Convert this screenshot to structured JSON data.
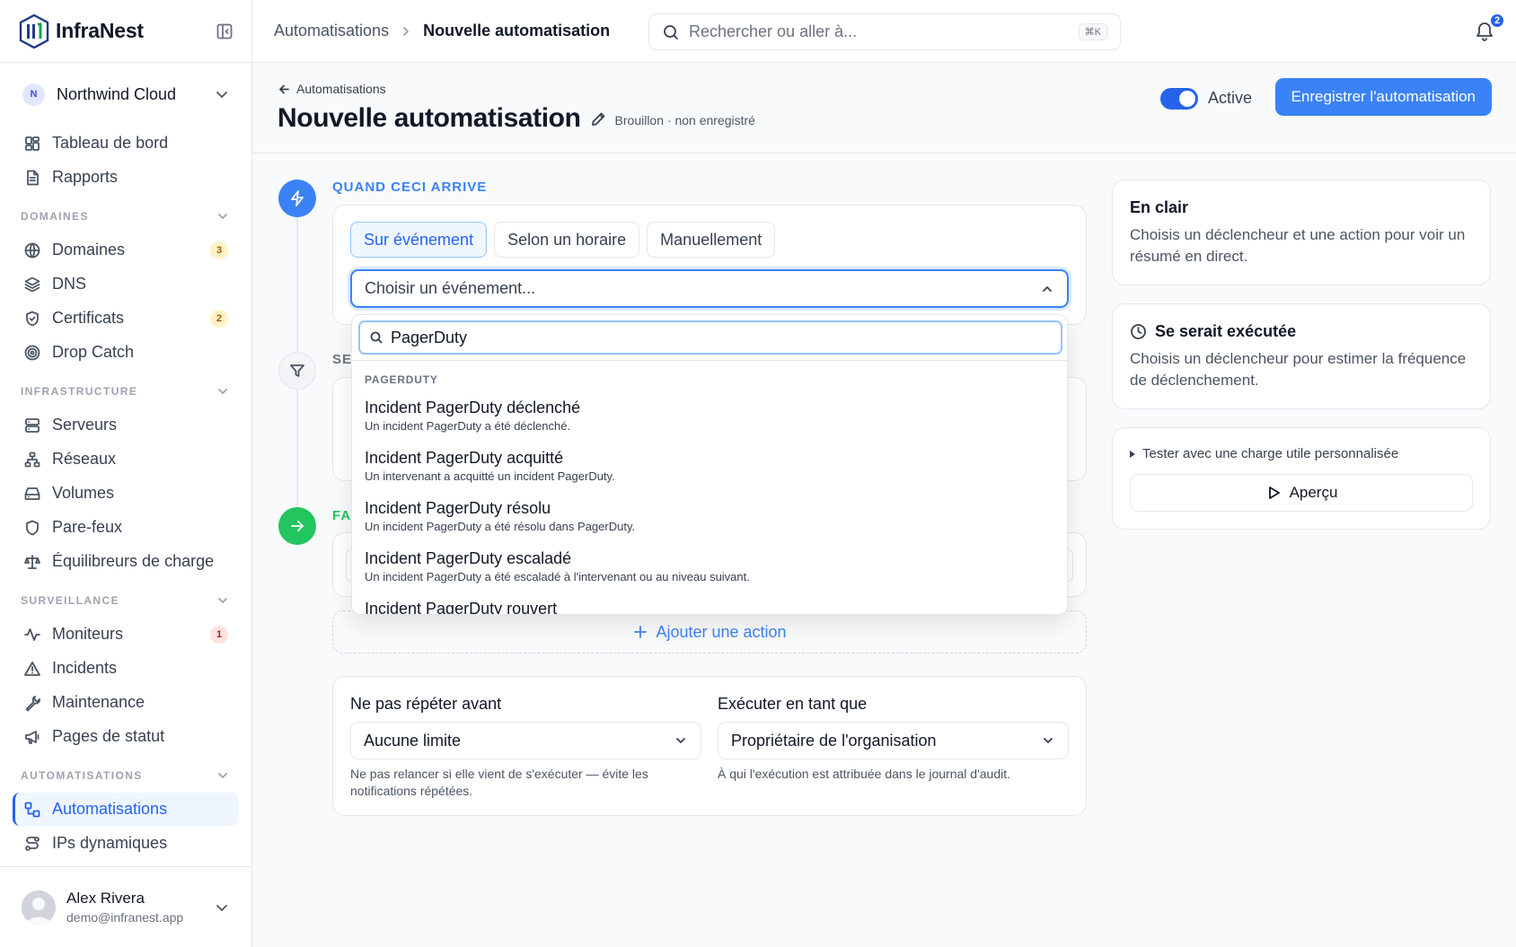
{
  "brand": {
    "name": "InfraNest"
  },
  "org": {
    "initial": "N",
    "name": "Northwind Cloud"
  },
  "nav": {
    "top": [
      {
        "label": "Tableau de bord",
        "icon": "dashboard-icon"
      },
      {
        "label": "Rapports",
        "icon": "report-icon"
      }
    ],
    "sections": [
      {
        "title": "DOMAINES",
        "items": [
          {
            "label": "Domaines",
            "icon": "globe-icon",
            "count": "3"
          },
          {
            "label": "DNS",
            "icon": "layers-icon"
          },
          {
            "label": "Certificats",
            "icon": "shield-check-icon",
            "count": "2"
          },
          {
            "label": "Drop Catch",
            "icon": "target-icon"
          }
        ]
      },
      {
        "title": "INFRASTRUCTURE",
        "items": [
          {
            "label": "Serveurs",
            "icon": "server-icon"
          },
          {
            "label": "Réseaux",
            "icon": "network-icon"
          },
          {
            "label": "Volumes",
            "icon": "hard-drive-icon"
          },
          {
            "label": "Pare-feux",
            "icon": "shield-icon"
          },
          {
            "label": "Équilibreurs de charge",
            "icon": "scale-icon"
          }
        ]
      },
      {
        "title": "SURVEILLANCE",
        "items": [
          {
            "label": "Moniteurs",
            "icon": "activity-icon",
            "count": "1"
          },
          {
            "label": "Incidents",
            "icon": "alert-triangle-icon"
          },
          {
            "label": "Maintenance",
            "icon": "wrench-icon"
          },
          {
            "label": "Pages de statut",
            "icon": "megaphone-icon"
          }
        ]
      },
      {
        "title": "AUTOMATISATIONS",
        "items": [
          {
            "label": "Automatisations",
            "icon": "workflow-icon",
            "active": true
          },
          {
            "label": "IPs dynamiques",
            "icon": "route-icon"
          }
        ]
      }
    ]
  },
  "user": {
    "name": "Alex Rivera",
    "email": "demo@infranest.app"
  },
  "topbar": {
    "crumb_parent": "Automatisations",
    "crumb_current": "Nouvelle automatisation",
    "search_placeholder": "Rechercher ou aller à...",
    "search_shortcut": "⌘K",
    "notif_count": "2"
  },
  "header": {
    "back_label": "Automatisations",
    "title": "Nouvelle automatisation",
    "status": "Brouillon · non enregistré",
    "active_label": "Active",
    "save_label": "Enregistrer l'automatisation"
  },
  "trigger": {
    "label": "QUAND CECI ARRIVE",
    "tabs": [
      "Sur événement",
      "Selon un horaire",
      "Manuellement"
    ],
    "event_placeholder": "Choisir un événement..."
  },
  "filter": {
    "label": "SE"
  },
  "action": {
    "label": "FA",
    "add_label": "Ajouter une action"
  },
  "dropdown": {
    "query": "PagerDuty",
    "group": "PAGERDUTY",
    "options": [
      {
        "title": "Incident PagerDuty déclenché",
        "desc": "Un incident PagerDuty a été déclenché."
      },
      {
        "title": "Incident PagerDuty acquitté",
        "desc": "Un intervenant a acquitté un incident PagerDuty."
      },
      {
        "title": "Incident PagerDuty résolu",
        "desc": "Un incident PagerDuty a été résolu dans PagerDuty."
      },
      {
        "title": "Incident PagerDuty escaladé",
        "desc": "Un incident PagerDuty a été escaladé à l'intervenant ou au niveau suivant."
      },
      {
        "title": "Incident PagerDuty rouvert",
        "desc": ""
      }
    ]
  },
  "options": {
    "repeat_label": "Ne pas répéter avant",
    "repeat_value": "Aucune limite",
    "repeat_help": "Ne pas relancer si elle vient de s'exécuter — évite les notifications répétées.",
    "run_as_label": "Exécuter en tant que",
    "run_as_value": "Propriétaire de l'organisation",
    "run_as_help": "À qui l'exécution est attribuée dans le journal d'audit."
  },
  "summary": {
    "title": "En clair",
    "text": "Choisis un déclencheur et une action pour voir un résumé en direct."
  },
  "frequency": {
    "title": "Se serait exécutée",
    "text": "Choisis un déclencheur pour estimer la fréquence de déclenchement."
  },
  "test": {
    "summary_label": "Tester avec une charge utile personnalisée",
    "preview_label": "Aperçu"
  }
}
